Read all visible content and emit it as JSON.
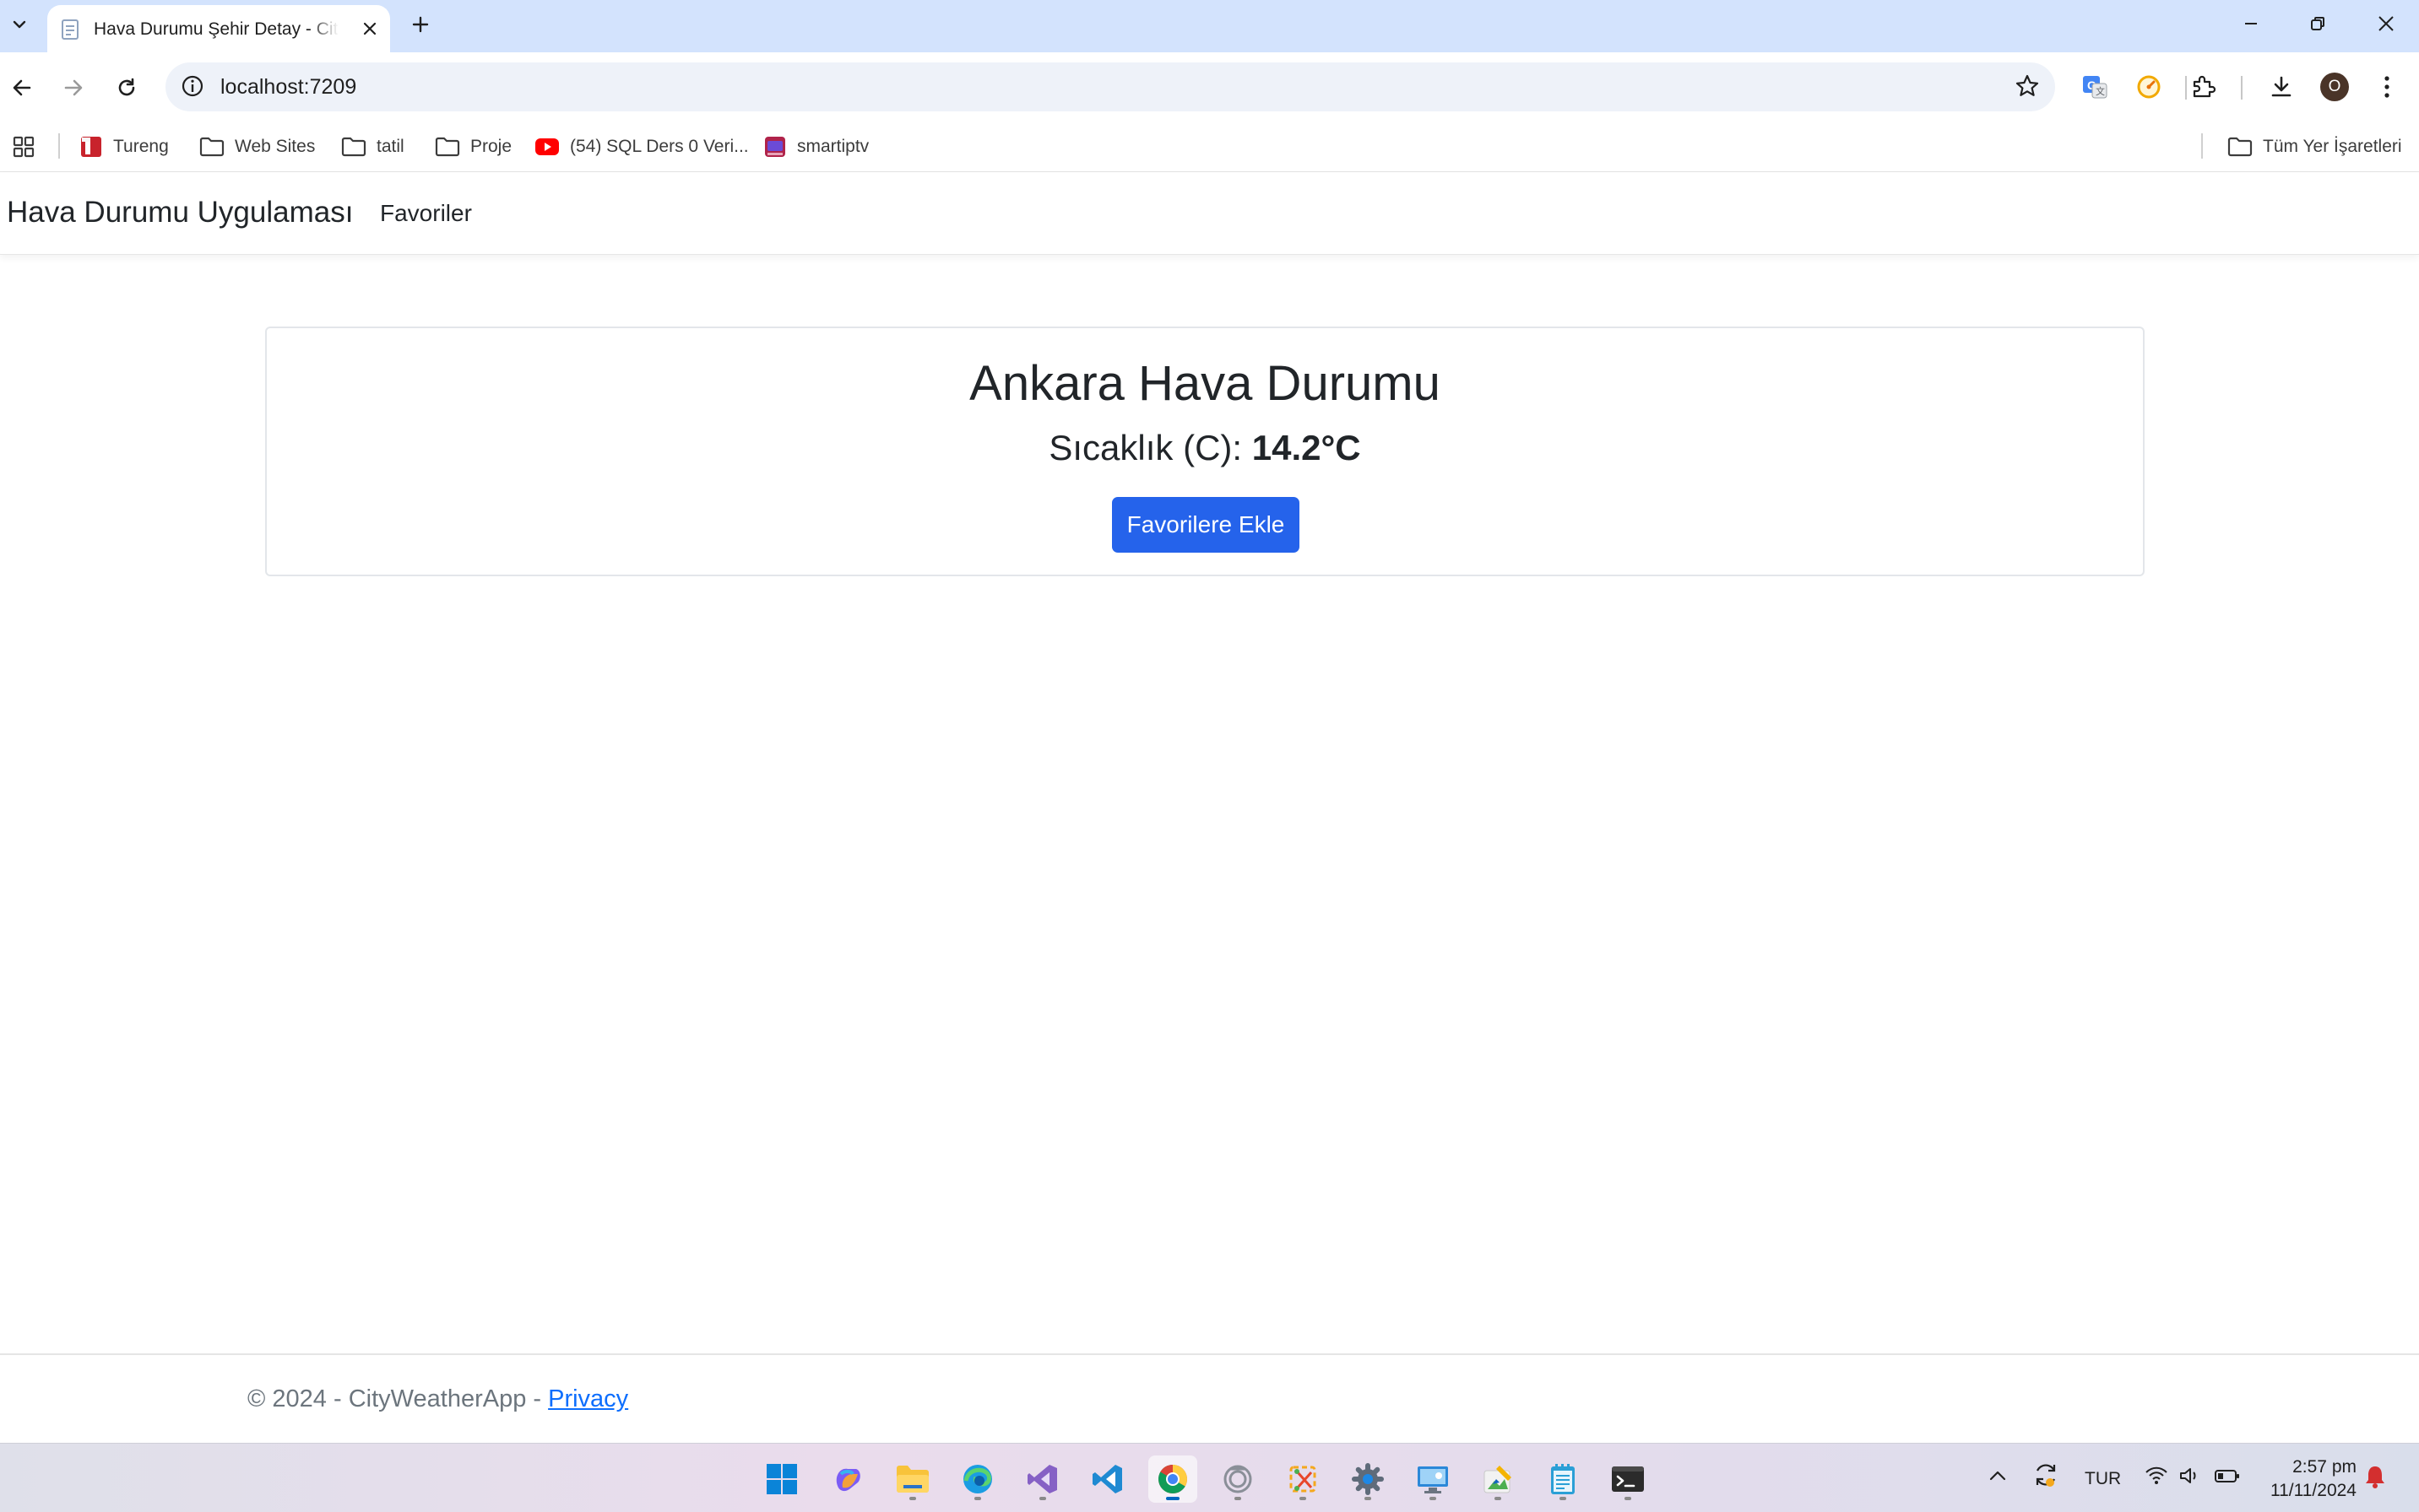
{
  "browser": {
    "tab": {
      "title": "Hava Durumu Şehir Detay - CityWeatherApp"
    },
    "address_bar": {
      "url": "localhost:7209"
    },
    "profile_initial": "O",
    "bookmarks": [
      {
        "label": "Tureng",
        "icon": "tureng-icon"
      },
      {
        "label": "Web Sites",
        "icon": "folder-icon"
      },
      {
        "label": "tatil",
        "icon": "folder-icon"
      },
      {
        "label": "Proje",
        "icon": "folder-icon"
      },
      {
        "label": "(54) SQL Ders 0 Veri...",
        "icon": "youtube-icon"
      },
      {
        "label": "smartiptv",
        "icon": "smartiptv-icon"
      }
    ],
    "all_bookmarks_label": "Tüm Yer İşaretleri"
  },
  "page": {
    "navbar": {
      "brand": "Hava Durumu Uygulaması",
      "links": [
        "Favoriler"
      ]
    },
    "card": {
      "title": "Ankara Hava Durumu",
      "temperature_label": "Sıcaklık (C):",
      "temperature_value": "14.2°C",
      "add_favorite_button": "Favorilere Ekle"
    },
    "footer": {
      "copyright": "© 2024 - CityWeatherApp - ",
      "privacy_link": "Privacy"
    }
  },
  "taskbar": {
    "apps": [
      "start",
      "copilot",
      "file-explorer",
      "edge",
      "visual-studio",
      "vscode",
      "chrome",
      "app-ring",
      "snipping-tool",
      "settings",
      "remote-desktop",
      "paint",
      "notepad",
      "terminal"
    ],
    "active_app": "chrome",
    "language": "TUR",
    "time": "2:57 pm",
    "date": "11/11/2024"
  },
  "colors": {
    "accent_button": "#2563eb",
    "link": "#0d6efd",
    "tab_strip": "#d3e3fd"
  }
}
